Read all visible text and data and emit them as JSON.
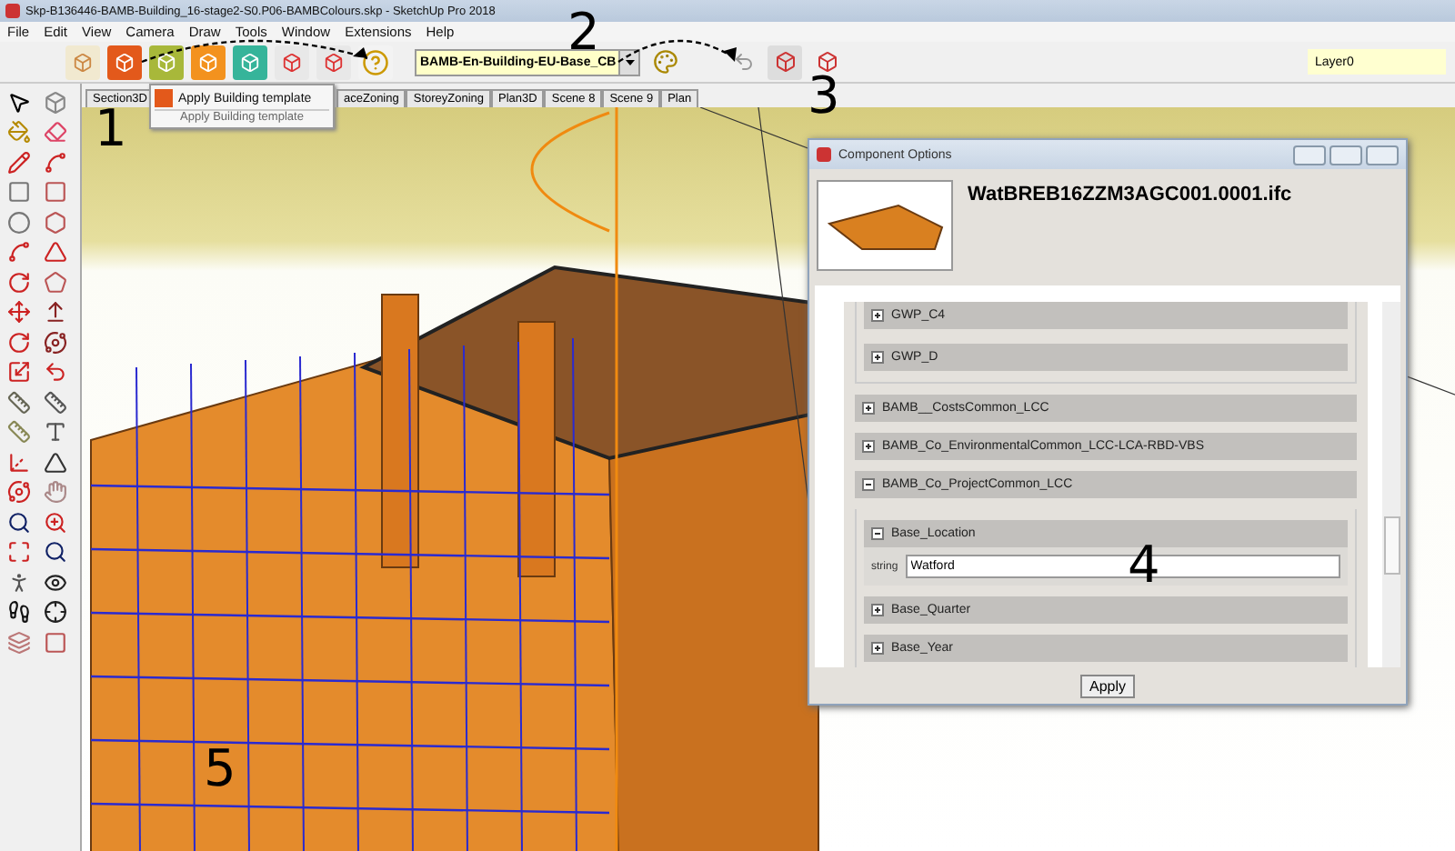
{
  "window": {
    "title": "Skp-B136446-BAMB-Building_16-stage2-S0.P06-BAMBColours.skp - SketchUp Pro 2018"
  },
  "menu": [
    "File",
    "Edit",
    "View",
    "Camera",
    "Draw",
    "Tools",
    "Window",
    "Extensions",
    "Help"
  ],
  "template_dropdown": {
    "value": "BAMB-En-Building-EU-Base_CB"
  },
  "layer_field": {
    "value": "Layer0"
  },
  "scene_tabs": [
    {
      "label": "Section3D",
      "selected": false
    },
    {
      "label": "aceZoning",
      "selected": false
    },
    {
      "label": "StoreyZoning",
      "selected": false
    },
    {
      "label": "Plan3D",
      "selected": false
    },
    {
      "label": "Scene 8",
      "selected": false
    },
    {
      "label": "Scene 9",
      "selected": false
    },
    {
      "label": "Plan",
      "selected": false
    }
  ],
  "tooltip": {
    "title": "Apply Building template",
    "subtitle": "Apply Building template"
  },
  "dialog": {
    "title": "Component Options",
    "component_name": "WatBREB16ZZM3AGC001.0001.ifc",
    "upper_group_items": [
      {
        "label": "GWP_C4",
        "expanded": false
      },
      {
        "label": "GWP_D",
        "expanded": false
      }
    ],
    "groups": [
      {
        "label": "BAMB__CostsCommon_LCC",
        "expanded": false
      },
      {
        "label": "BAMB_Co_EnvironmentalCommon_LCC-LCA-RBD-VBS",
        "expanded": false
      },
      {
        "label": "BAMB_Co_ProjectCommon_LCC",
        "expanded": true,
        "children": [
          {
            "label": "Base_Location",
            "expanded": true,
            "field": {
              "type": "string",
              "value": "Watford"
            }
          },
          {
            "label": "Base_Quarter",
            "expanded": false
          },
          {
            "label": "Base_Year",
            "expanded": false
          }
        ]
      }
    ],
    "apply_button": "Apply"
  },
  "annotations": [
    "1",
    "2",
    "3",
    "4",
    "5"
  ]
}
